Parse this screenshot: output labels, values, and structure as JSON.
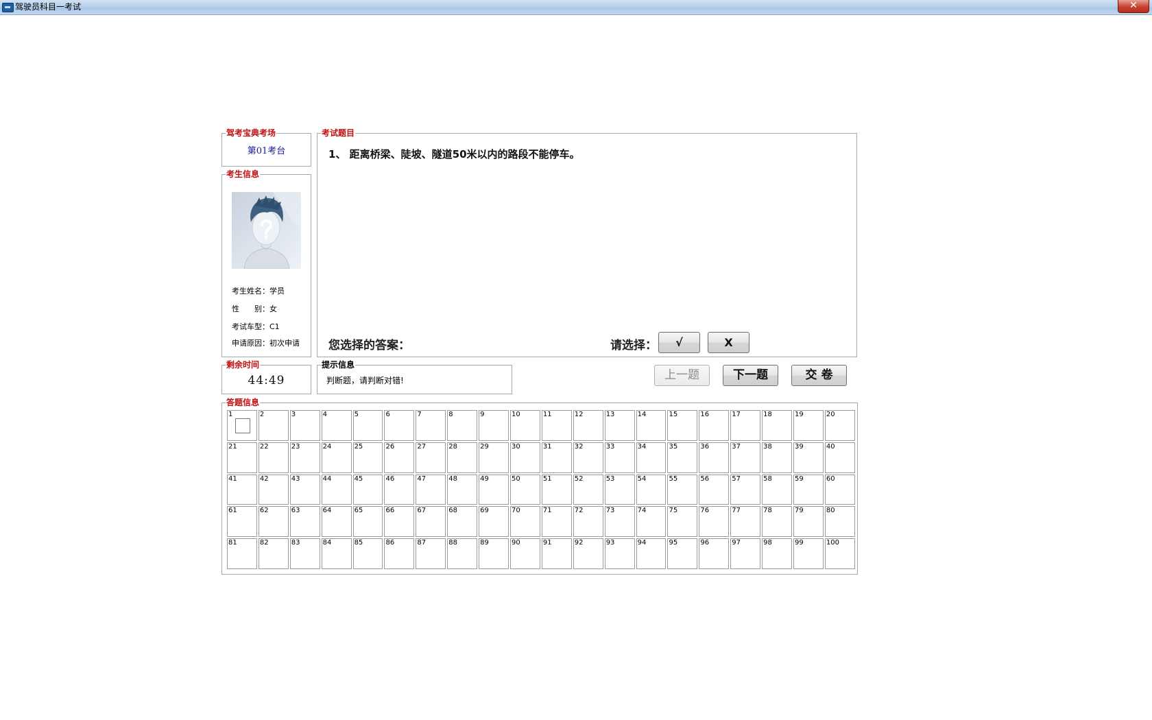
{
  "window": {
    "title": "驾驶员科目一考试",
    "close_label": "✕"
  },
  "station": {
    "group_label": "驾考宝典考场",
    "name": "第01考台"
  },
  "candidate": {
    "group_label": "考生信息",
    "name_label": "考生姓名：",
    "name": "学员",
    "gender_label": "性　　别：",
    "gender": "女",
    "car_type_label": "考试车型：",
    "car_type": "C1",
    "reason_label": "申请原因：",
    "reason": "初次申请"
  },
  "question": {
    "group_label": "考试题目",
    "text": "1、 距离桥梁、陡坡、隧道50米以内的路段不能停车。",
    "your_answer_label": "您选择的答案：",
    "choose_label": "请选择：",
    "options": [
      "√",
      "X"
    ]
  },
  "timer": {
    "group_label": "剩余时间",
    "remaining": "44:49"
  },
  "hint": {
    "group_label": "提示信息",
    "text": "判断题，请判断对错!"
  },
  "nav": {
    "prev_label": "上一题",
    "next_label": "下一题",
    "submit_label": "交 卷"
  },
  "answers": {
    "group_label": "答题信息",
    "total": 100,
    "current": 1
  },
  "colors": {
    "group_label": "#c01010",
    "station_text": "#1a1aa0"
  }
}
